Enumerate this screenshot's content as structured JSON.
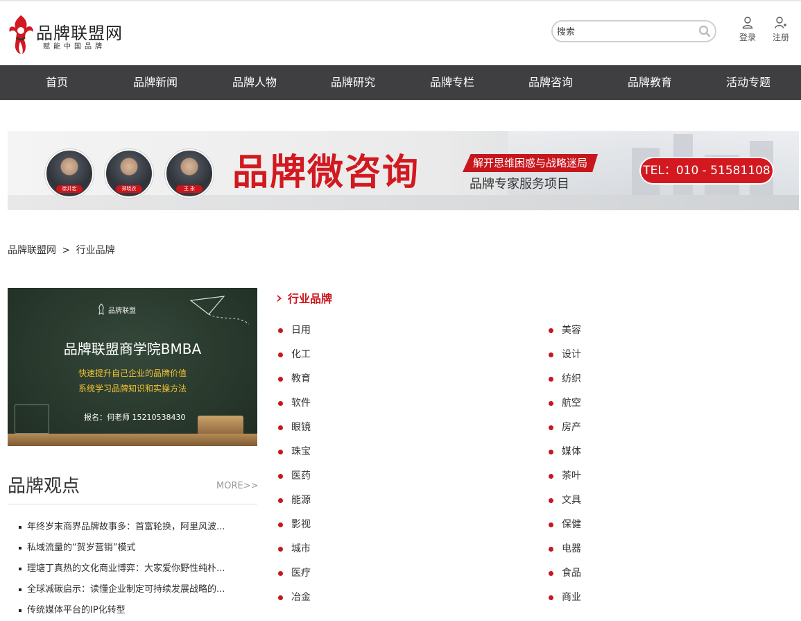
{
  "header": {
    "logo_title": "品牌联盟网",
    "logo_subtitle": "赋能中国品牌",
    "search_placeholder": "搜索",
    "login_label": "登录",
    "register_label": "注册"
  },
  "nav": {
    "items": [
      {
        "label": "首页"
      },
      {
        "label": "品牌新闻"
      },
      {
        "label": "品牌人物"
      },
      {
        "label": "品牌研究"
      },
      {
        "label": "品牌专栏"
      },
      {
        "label": "品牌咨询"
      },
      {
        "label": "品牌教育"
      },
      {
        "label": "活动专题"
      }
    ]
  },
  "banner": {
    "people": [
      "徐井宏",
      "郑晓农",
      "王 永"
    ],
    "headline": "品牌微咨询",
    "tag": "解开思维困惑与战略迷局",
    "subheadline": "品牌专家服务项目",
    "tel": "TEL：010 - 51581108"
  },
  "breadcrumb": {
    "home": "品牌联盟网",
    "separator": ">",
    "current": "行业品牌"
  },
  "promo": {
    "brand": "品牌联盟",
    "title": "品牌联盟商学院BMBA",
    "line1": "快速提升自己企业的品牌价值",
    "line2": "系统学习品牌知识和实操方法",
    "contact": "报名：何老师  15210538430"
  },
  "opinions": {
    "title": "品牌观点",
    "more": "MORE>>",
    "items": [
      "年终岁末商界品牌故事多：首富轮换，阿里风波...",
      "私域流量的“贺岁营销”模式",
      "理塘丁真热的文化商业博弈：大家爱你野性纯朴...",
      "全球减碳启示：读懂企业制定可持续发展战略的...",
      "传统媒体平台的IP化转型"
    ]
  },
  "industry": {
    "title": "行业品牌",
    "left": [
      "日用",
      "化工",
      "教育",
      "软件",
      "眼镜",
      "珠宝",
      "医药",
      "能源",
      "影视",
      "城市",
      "医疗",
      "冶金"
    ],
    "right": [
      "美容",
      "设计",
      "纺织",
      "航空",
      "房产",
      "媒体",
      "茶叶",
      "文具",
      "保健",
      "电器",
      "食品",
      "商业"
    ]
  },
  "colors": {
    "brand_red": "#c8161d",
    "nav_bg": "#3f3f41"
  }
}
